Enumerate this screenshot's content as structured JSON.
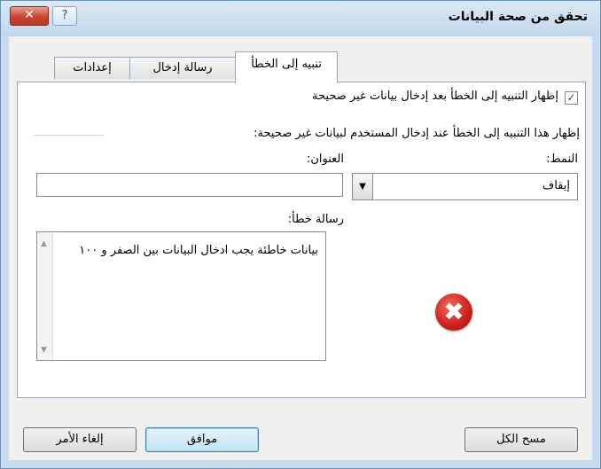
{
  "window": {
    "title": "تحقق من صحة البيانات",
    "close_glyph": "✕",
    "help_glyph": "?"
  },
  "tabs": [
    {
      "label": "تنبيه إلى الخطأ",
      "active": true
    },
    {
      "label": "رسالة إدخال",
      "active": false
    },
    {
      "label": "إعدادات",
      "active": false
    }
  ],
  "alert": {
    "show_checkbox_label": "إظهار التنبيه إلى الخطأ بعد إدخال بيانات غير صحيحة",
    "show_checked": true,
    "check_glyph": "✓",
    "group_label": "إظهار هذا التنبيه إلى الخطأ عند إدخال المستخدم لبيانات غير صحيحة:",
    "style_label": "النمط:",
    "style_value": "إيقاف",
    "title_label": "العنوان:",
    "title_value": "",
    "message_label": "رسالة خطأ:",
    "message_value": "بيانات خاطئة يجب ادخال البيانات بين الصفر و ١٠٠",
    "icon": "error-stop-icon",
    "icon_glyph": "✖"
  },
  "buttons": {
    "clear_all": "مسح الكل",
    "ok": "موافق",
    "cancel": "إلغاء الأمر"
  },
  "colors": {
    "titlebar": "#c7dbef",
    "close": "#c7452f",
    "error": "#c8201a"
  }
}
